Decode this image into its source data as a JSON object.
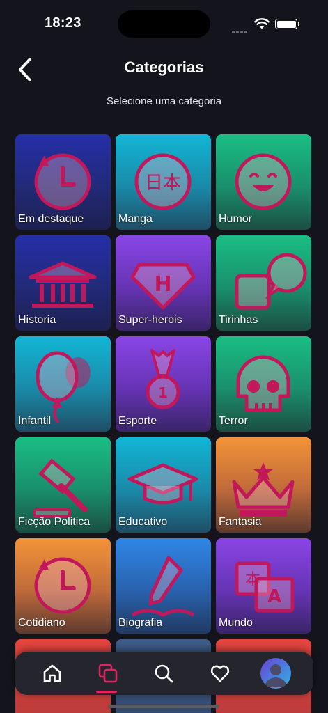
{
  "status_bar": {
    "time": "18:23"
  },
  "header": {
    "title": "Categorias",
    "subtitle": "Selecione uma categoria"
  },
  "categories": [
    {
      "label": "Em destaque",
      "icon": "clock-icon",
      "gradient": "blue"
    },
    {
      "label": "Manga",
      "icon": "kanji-icon",
      "gradient": "cyan"
    },
    {
      "label": "Humor",
      "icon": "smiley-icon",
      "gradient": "green"
    },
    {
      "label": "Historia",
      "icon": "temple-icon",
      "gradient": "blue"
    },
    {
      "label": "Super-herois",
      "icon": "hero-emblem-icon",
      "gradient": "purple"
    },
    {
      "label": "Tirinhas",
      "icon": "speech-bubble-icon",
      "gradient": "green"
    },
    {
      "label": "Infantil",
      "icon": "balloon-icon",
      "gradient": "cyan"
    },
    {
      "label": "Esporte",
      "icon": "medal-icon",
      "gradient": "purple"
    },
    {
      "label": "Terror",
      "icon": "skull-icon",
      "gradient": "green"
    },
    {
      "label": "Ficção Politica",
      "icon": "gavel-icon",
      "gradient": "green"
    },
    {
      "label": "Educativo",
      "icon": "graduation-cap-icon",
      "gradient": "cyan"
    },
    {
      "label": "Fantasia",
      "icon": "crown-icon",
      "gradient": "orange"
    },
    {
      "label": "Cotidiano",
      "icon": "clock-icon",
      "gradient": "orange"
    },
    {
      "label": "Biografia",
      "icon": "pen-book-icon",
      "gradient": "azure"
    },
    {
      "label": "Mundo",
      "icon": "translate-icon",
      "gradient": "purple"
    },
    {
      "label": "",
      "icon": "",
      "gradient": "red"
    },
    {
      "label": "",
      "icon": "",
      "gradient": "slate"
    },
    {
      "label": "",
      "icon": "",
      "gradient": "red"
    }
  ],
  "bottom_nav": {
    "items": [
      {
        "icon": "home-icon"
      },
      {
        "icon": "categories-icon",
        "active": true
      },
      {
        "icon": "search-icon"
      },
      {
        "icon": "heart-icon"
      },
      {
        "icon": "profile-avatar"
      }
    ],
    "active_color": "#e0245e"
  },
  "colors": {
    "icon_stroke": "#c2185b",
    "background": "#14141c"
  }
}
